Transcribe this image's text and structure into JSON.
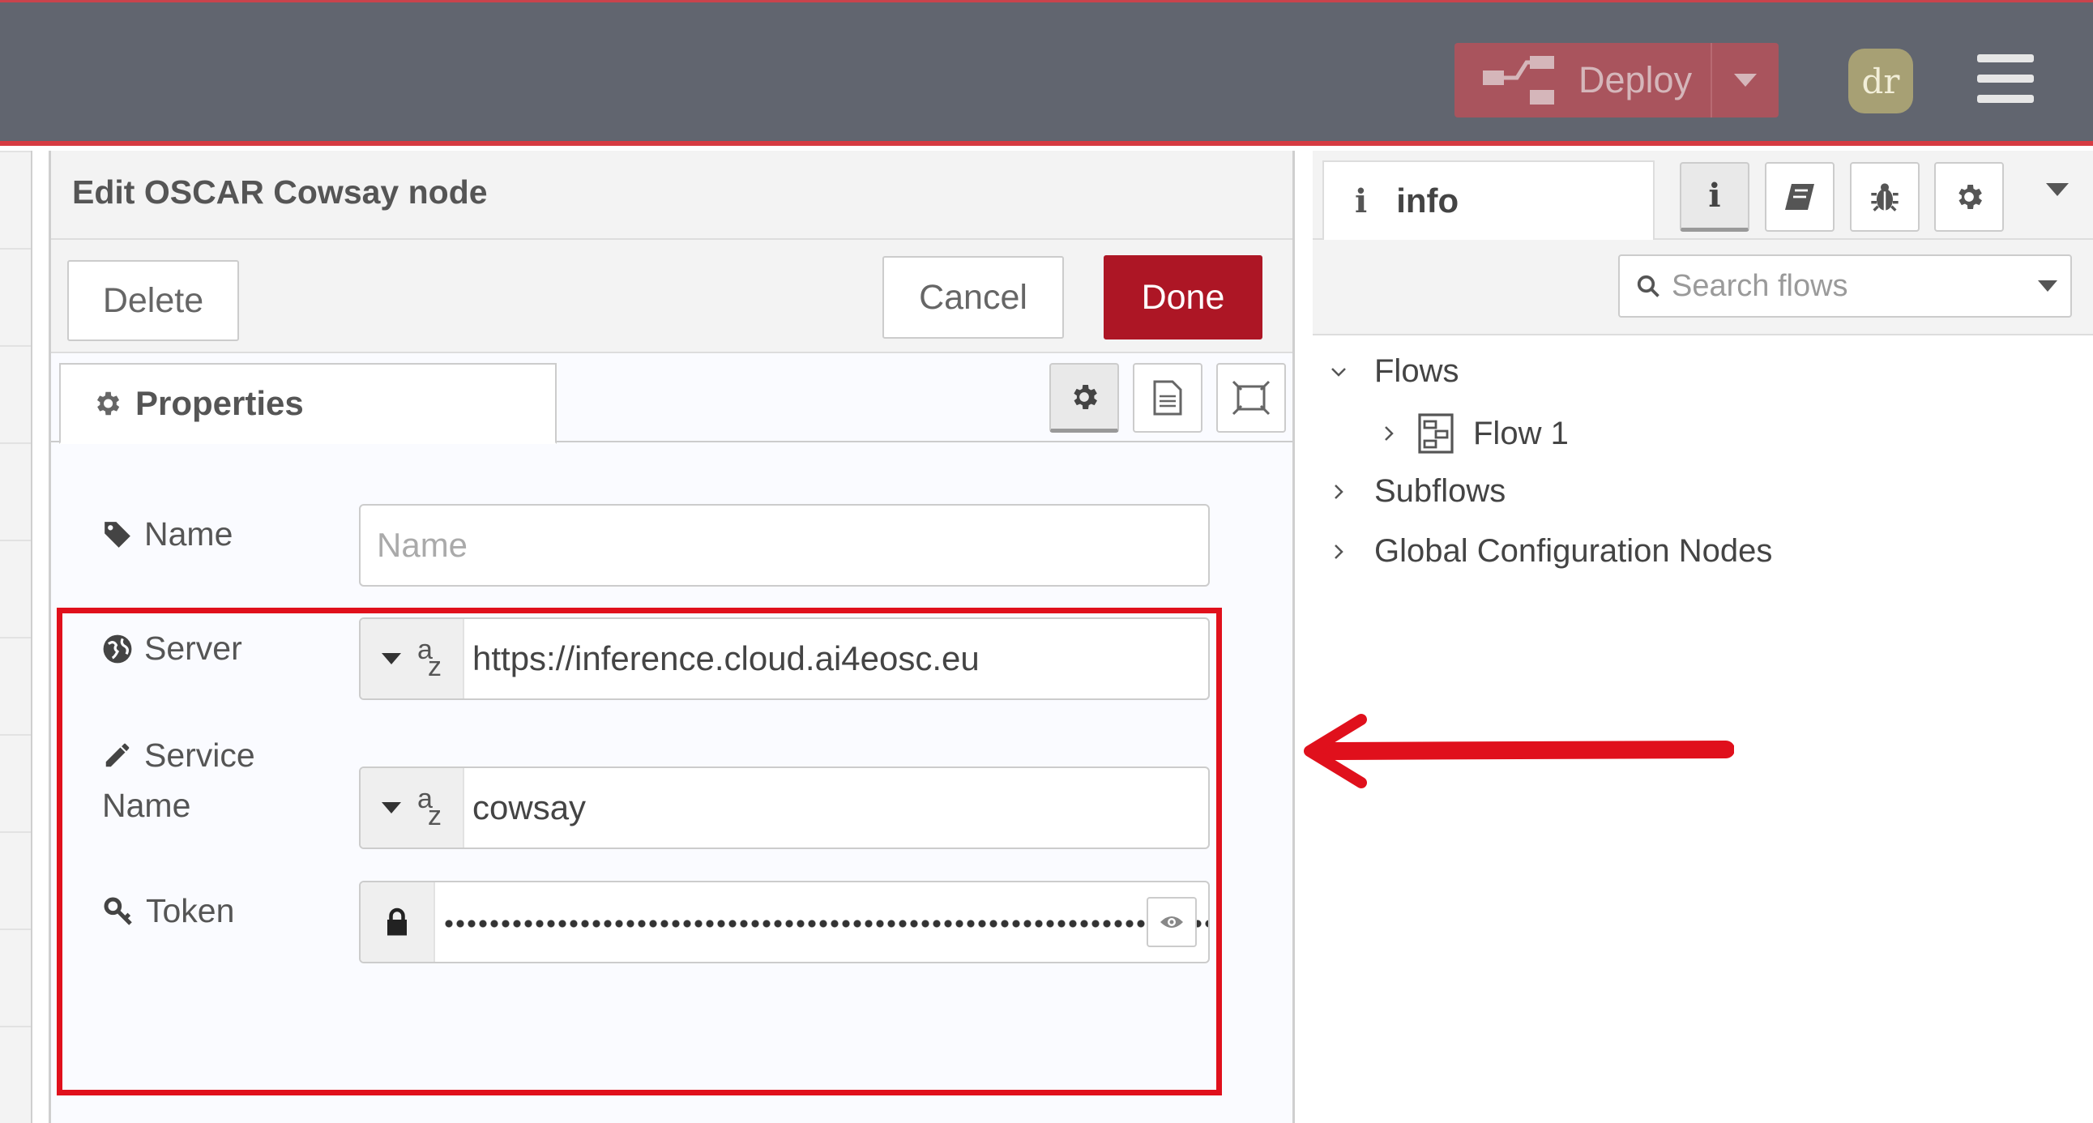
{
  "header": {
    "deploy_label": "Deploy",
    "avatar_initials": "dr",
    "accent_color": "#d63b42"
  },
  "tray": {
    "title": "Edit OSCAR Cowsay node",
    "delete_label": "Delete",
    "cancel_label": "Cancel",
    "done_label": "Done",
    "tab_properties": "Properties",
    "fields": {
      "name_label": "Name",
      "name_placeholder": "Name",
      "server_label": "Server",
      "server_value": "https://inference.cloud.ai4eosc.eu",
      "service_label_line1": "Service",
      "service_label_line2": "Name",
      "service_value": "cowsay",
      "token_label": "Token"
    },
    "typed_input_glyph_a": "a",
    "typed_input_glyph_z": "z"
  },
  "sidebar": {
    "tab_label": "info",
    "tab_icon_text": "i",
    "search_placeholder": "Search flows",
    "tree": {
      "flows": "Flows",
      "flow1": "Flow 1",
      "subflows": "Subflows",
      "global_config": "Global Configuration Nodes"
    }
  },
  "icons": [
    "deploy-icon",
    "chevron-down-icon",
    "hamburger-menu-icon",
    "gear-icon",
    "document-icon",
    "expand-icon",
    "tag-icon",
    "globe-icon",
    "pencil-icon",
    "key-icon",
    "lock-icon",
    "eye-icon",
    "info-icon",
    "book-icon",
    "bug-icon",
    "search-icon",
    "flow-icon",
    "chevron-right-icon",
    "red-arrow-annotation"
  ]
}
